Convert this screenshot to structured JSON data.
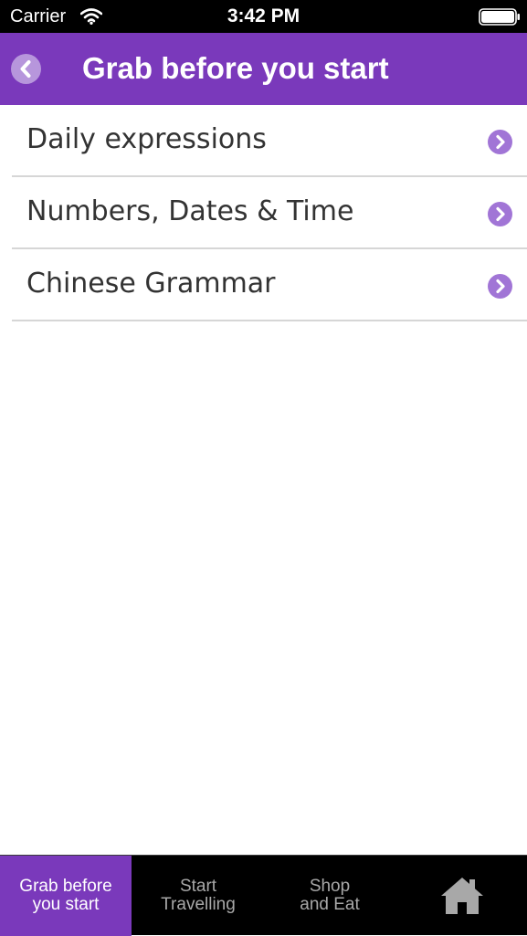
{
  "status_bar": {
    "carrier": "Carrier",
    "time": "3:42 PM"
  },
  "nav": {
    "title": "Grab before you start",
    "back_icon": "chevron-left-icon"
  },
  "menu": {
    "items": [
      {
        "label": "Daily expressions",
        "icon": "chevron-right-circle-icon"
      },
      {
        "label": "Numbers, Dates & Time",
        "icon": "chevron-right-circle-icon"
      },
      {
        "label": "Chinese Grammar",
        "icon": "chevron-right-circle-icon"
      }
    ]
  },
  "tabs": [
    {
      "line1": "Grab before",
      "line2": "you start",
      "active": true
    },
    {
      "line1": "Start",
      "line2": "Travelling",
      "active": false
    },
    {
      "line1": "Shop",
      "line2": "and Eat",
      "active": false
    },
    {
      "icon": "home-icon",
      "active": false
    }
  ],
  "colors": {
    "brand_purple": "#7a39bb",
    "accent_purple": "#a175d6",
    "tab_inactive_text": "#a8a8a8"
  }
}
